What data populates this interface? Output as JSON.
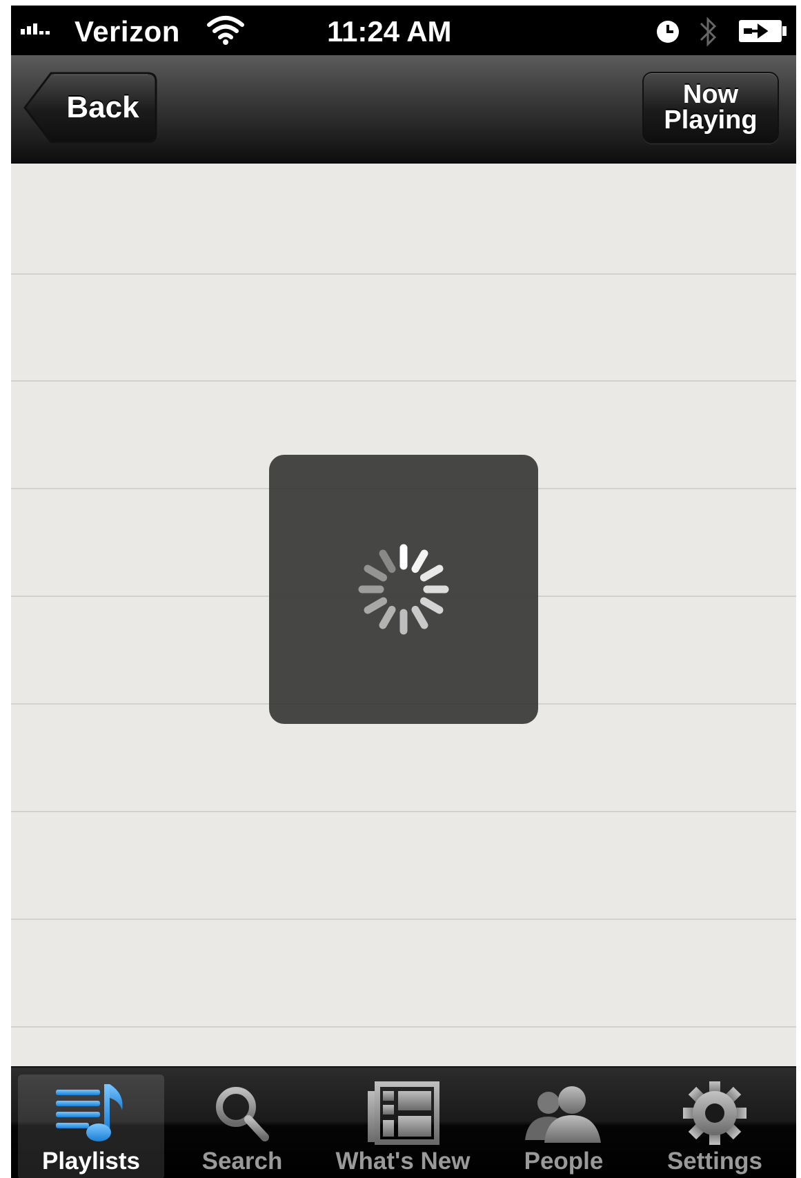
{
  "status_bar": {
    "carrier": "Verizon",
    "time": "11:24 AM",
    "icons": [
      "signal-icon",
      "wifi-icon",
      "alarm-icon",
      "bluetooth-icon",
      "battery-icon"
    ]
  },
  "nav_bar": {
    "back_label": "Back",
    "now_playing_line1": "Now",
    "now_playing_line2": "Playing"
  },
  "loading": {
    "icon": "spinner-icon"
  },
  "tab_bar": {
    "accent_color": "#3aa0ea",
    "tabs": [
      {
        "label": "Playlists",
        "icon": "playlists-icon",
        "active": true
      },
      {
        "label": "Search",
        "icon": "search-icon",
        "active": false
      },
      {
        "label": "What's New",
        "icon": "whats-new-icon",
        "active": false
      },
      {
        "label": "People",
        "icon": "people-icon",
        "active": false
      },
      {
        "label": "Settings",
        "icon": "settings-icon",
        "active": false
      }
    ]
  }
}
